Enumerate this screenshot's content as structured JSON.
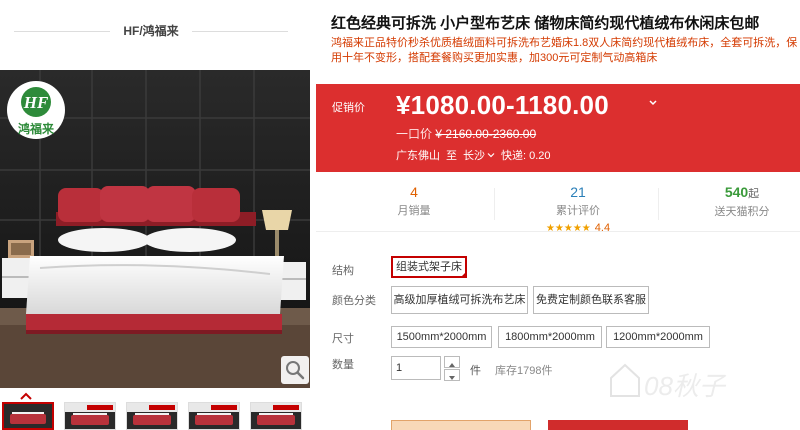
{
  "shop": {
    "name": "HF/鸿福来"
  },
  "logo": {
    "text_top": "HF",
    "text_bottom": "鸿福来"
  },
  "product": {
    "title": "红色经典可拆洗 小户型布艺床 储物床简约现代植绒布休闲床包邮",
    "subtitle": "鸿福来正品特价秒杀优质植绒面料可拆洗布艺婚床1.8双人床简约现代植绒布床，全套可拆洗，保用十年不变形，搭配套餐购买更加实惠，加300元可定制气动高箱床"
  },
  "price": {
    "label": "促销价",
    "value": "¥1080.00-1180.00",
    "original_label": "一口价",
    "original_value": "¥ 2160.00-2360.00",
    "ship_from": "广东佛山",
    "ship_to_label": "至",
    "ship_to": "长沙",
    "shipping": "快递: 0.20",
    "colors": {
      "bg": "#dc2f2f"
    }
  },
  "stats": {
    "monthly_sales": {
      "value": "4",
      "label": "月销量"
    },
    "reviews": {
      "value": "21",
      "label": "累计评价",
      "stars": "★★★★★",
      "rating": "4.4"
    },
    "points": {
      "value": "540",
      "unit": "起",
      "label": "送天猫积分"
    }
  },
  "options": {
    "structure": {
      "label": "结构",
      "items": [
        "组装式架子床"
      ],
      "selected": "组装式架子床"
    },
    "color": {
      "label": "颜色分类",
      "items": [
        "高级加厚植绒可拆洗布艺床",
        "免费定制颜色联系客服"
      ]
    },
    "size": {
      "label": "尺寸",
      "items": [
        "1500mm*2000mm",
        "1800mm*2000mm",
        "1200mm*2000mm"
      ]
    },
    "quantity": {
      "label": "数量",
      "value": "1",
      "unit": "件",
      "stock": "库存1798件"
    }
  },
  "watermark": "08秋子",
  "icons": {
    "zoom": "magnifier-icon",
    "thumb_up": "chevron-up-icon",
    "price_caret": "chevron-down-icon",
    "stepper_up": "caret-up-icon",
    "stepper_down": "caret-down-icon",
    "location_caret": "chevron-down-icon"
  }
}
